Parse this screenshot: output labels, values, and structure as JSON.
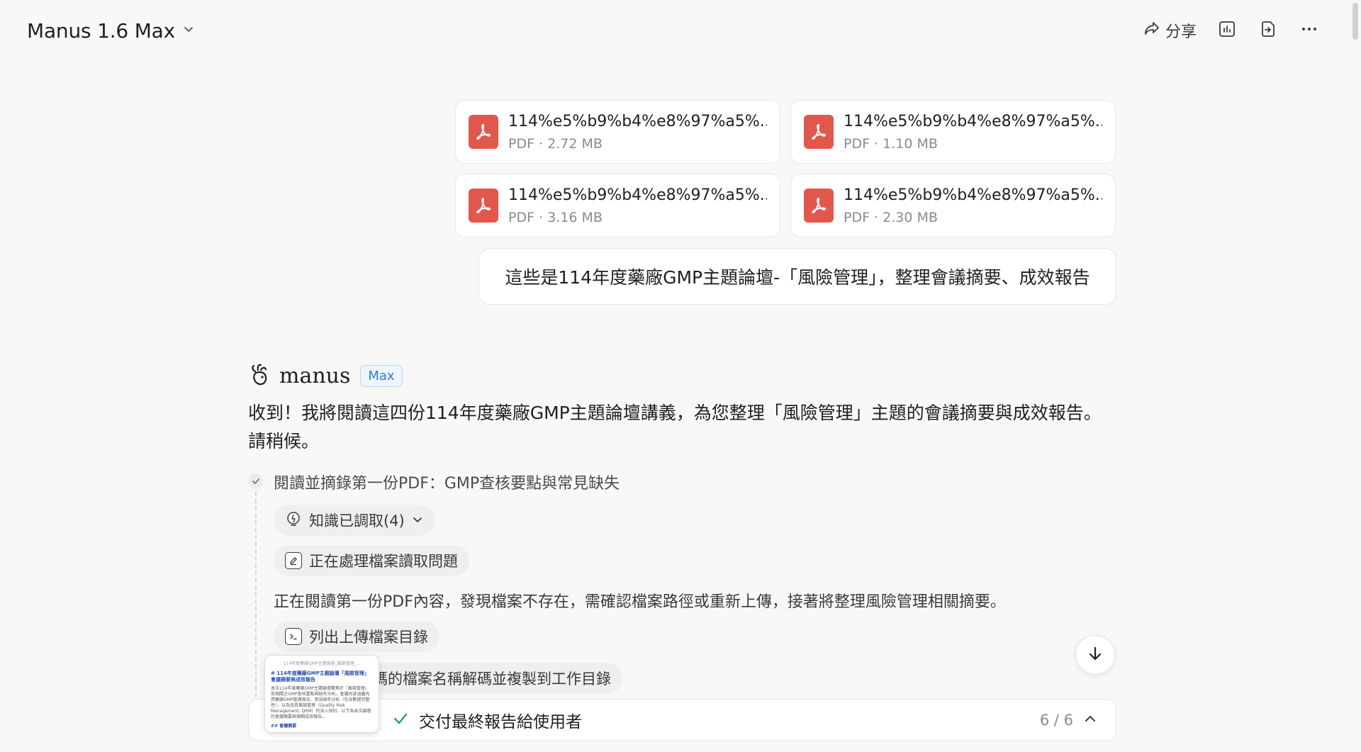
{
  "header": {
    "model_name": "Manus 1.6 Max",
    "share_label": "分享"
  },
  "icons": {
    "chevron": "chevron-down-icon",
    "share": "share-icon",
    "dashboard": "chart-icon",
    "export": "export-icon",
    "more": "more-icon",
    "pdf": "pdf-icon"
  },
  "files": [
    {
      "name": "114%e5%b9%b4%e8%97%a5%...",
      "meta": "PDF · 2.72 MB"
    },
    {
      "name": "114%e5%b9%b4%e8%97%a5%...",
      "meta": "PDF · 1.10 MB"
    },
    {
      "name": "114%e5%b9%b4%e8%97%a5%...",
      "meta": "PDF · 3.16 MB"
    },
    {
      "name": "114%e5%b9%b4%e8%97%a5%...",
      "meta": "PDF · 2.30 MB"
    }
  ],
  "user_message": "這些是114年度藥廠GMP主題論壇-「風險管理」，整理會議摘要、成效報告",
  "agent": {
    "name": "manus",
    "badge": "Max",
    "reply": "收到！我將閱讀這四份114年度藥廠GMP主題論壇講義，為您整理「風險管理」主題的會議摘要與成效報告。請稍候。"
  },
  "step": {
    "title": "閱讀並摘錄第一份PDF：GMP查核要點與常見缺失",
    "knowledge_chip": "知識已調取(4)",
    "action1": "正在處理檔案讀取問題",
    "status_text": "正在閱讀第一份PDF內容，發現檔案不存在，需確認檔案路徑或重新上傳，接著將整理風險管理相關摘要。",
    "action2": "列出上傳檔案目錄",
    "action3_partial": "碼的檔案名稱解碼並複製到工作目錄"
  },
  "task_bar": {
    "title": "交付最終報告給使用者",
    "progress": "6 / 6"
  },
  "thumbnail": {
    "top": "114年度藥廠GMP主題論壇_風險管理_...",
    "heading": "# 114年度藥廠GMP主題論壇「風險管理」會議摘要與成效報告",
    "body": "本次114年度藥廠GMP主題論壇聚焦於「風險管理」及相關之GMP查核重點與缺失分析。會議內容涵蓋內西藥廠GMP管理現況、常見缺失分析（包含數據完整性）、以及品質風險管理（Quality Risk Management, QRM）的深入探討。以下為本次論壇的會議摘要與預期成效報告。",
    "foot": "## 會議摘要"
  }
}
